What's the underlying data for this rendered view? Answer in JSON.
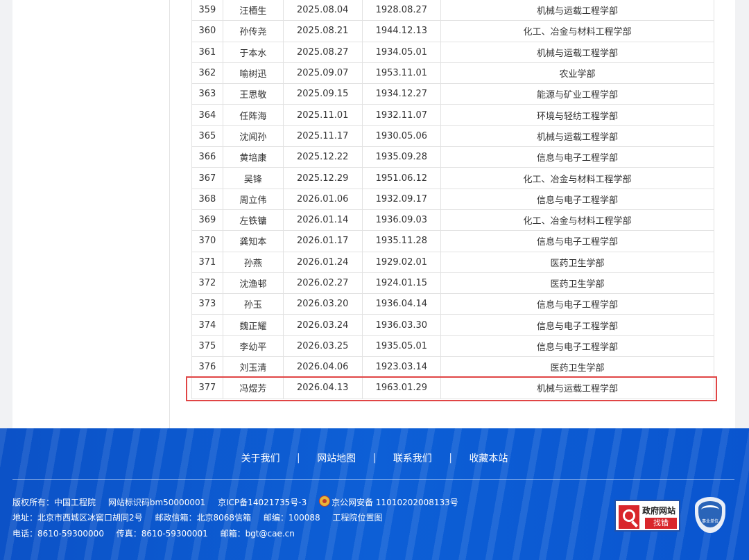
{
  "rows": [
    {
      "num": "359",
      "name": "汪槱生",
      "death_date": "2025.08.04",
      "birth_date": "1928.08.27",
      "department": "机械与运载工程学部"
    },
    {
      "num": "360",
      "name": "孙传尧",
      "death_date": "2025.08.21",
      "birth_date": "1944.12.13",
      "department": "化工、冶金与材料工程学部"
    },
    {
      "num": "361",
      "name": "于本水",
      "death_date": "2025.08.27",
      "birth_date": "1934.05.01",
      "department": "机械与运载工程学部"
    },
    {
      "num": "362",
      "name": "喻树迅",
      "death_date": "2025.09.07",
      "birth_date": "1953.11.01",
      "department": "农业学部"
    },
    {
      "num": "363",
      "name": "王思敬",
      "death_date": "2025.09.15",
      "birth_date": "1934.12.27",
      "department": "能源与矿业工程学部"
    },
    {
      "num": "364",
      "name": "任阵海",
      "death_date": "2025.11.01",
      "birth_date": "1932.11.07",
      "department": "环境与轻纺工程学部"
    },
    {
      "num": "365",
      "name": "沈闻孙",
      "death_date": "2025.11.17",
      "birth_date": "1930.05.06",
      "department": "机械与运载工程学部"
    },
    {
      "num": "366",
      "name": "黄培康",
      "death_date": "2025.12.22",
      "birth_date": "1935.09.28",
      "department": "信息与电子工程学部"
    },
    {
      "num": "367",
      "name": "吴锋",
      "death_date": "2025.12.29",
      "birth_date": "1951.06.12",
      "department": "化工、冶金与材料工程学部"
    },
    {
      "num": "368",
      "name": "周立伟",
      "death_date": "2026.01.06",
      "birth_date": "1932.09.17",
      "department": "信息与电子工程学部"
    },
    {
      "num": "369",
      "name": "左铁镛",
      "death_date": "2026.01.14",
      "birth_date": "1936.09.03",
      "department": "化工、冶金与材料工程学部"
    },
    {
      "num": "370",
      "name": "龚知本",
      "death_date": "2026.01.17",
      "birth_date": "1935.11.28",
      "department": "信息与电子工程学部"
    },
    {
      "num": "371",
      "name": "孙燕",
      "death_date": "2026.01.24",
      "birth_date": "1929.02.01",
      "department": "医药卫生学部"
    },
    {
      "num": "372",
      "name": "沈渔邨",
      "death_date": "2026.02.27",
      "birth_date": "1924.01.15",
      "department": "医药卫生学部"
    },
    {
      "num": "373",
      "name": "孙玉",
      "death_date": "2026.03.20",
      "birth_date": "1936.04.14",
      "department": "信息与电子工程学部"
    },
    {
      "num": "374",
      "name": "魏正耀",
      "death_date": "2026.03.24",
      "birth_date": "1936.03.30",
      "department": "信息与电子工程学部"
    },
    {
      "num": "375",
      "name": "李幼平",
      "death_date": "2026.03.25",
      "birth_date": "1935.05.01",
      "department": "信息与电子工程学部"
    },
    {
      "num": "376",
      "name": "刘玉清",
      "death_date": "2026.04.06",
      "birth_date": "1923.03.14",
      "department": "医药卫生学部"
    },
    {
      "num": "377",
      "name": "冯煜芳",
      "death_date": "2026.04.13",
      "birth_date": "1963.01.29",
      "department": "机械与运载工程学部"
    }
  ],
  "highlight_color": "#e04545",
  "footer": {
    "links": [
      "关于我们",
      "网站地图",
      "联系我们",
      "收藏本站"
    ],
    "separator": "|",
    "line1": [
      "版权所有：中国工程院",
      "网站标识码bm50000001",
      "京ICP备14021735号-3",
      "京公网安备 11010202008133号"
    ],
    "line2": [
      "地址：北京市西城区冰窖口胡同2号",
      "邮政信箱：北京8068信箱",
      "邮编：100088",
      "工程院位置图"
    ],
    "line3": [
      "电话：8610-59300000",
      "传真：8610-59300001",
      "邮箱：bgt@cae.cn"
    ],
    "gov_badge": {
      "title": "政府网站",
      "button": "找错"
    },
    "shiye_badge": "事业单位",
    "bg_color": "#0d5fd6"
  }
}
